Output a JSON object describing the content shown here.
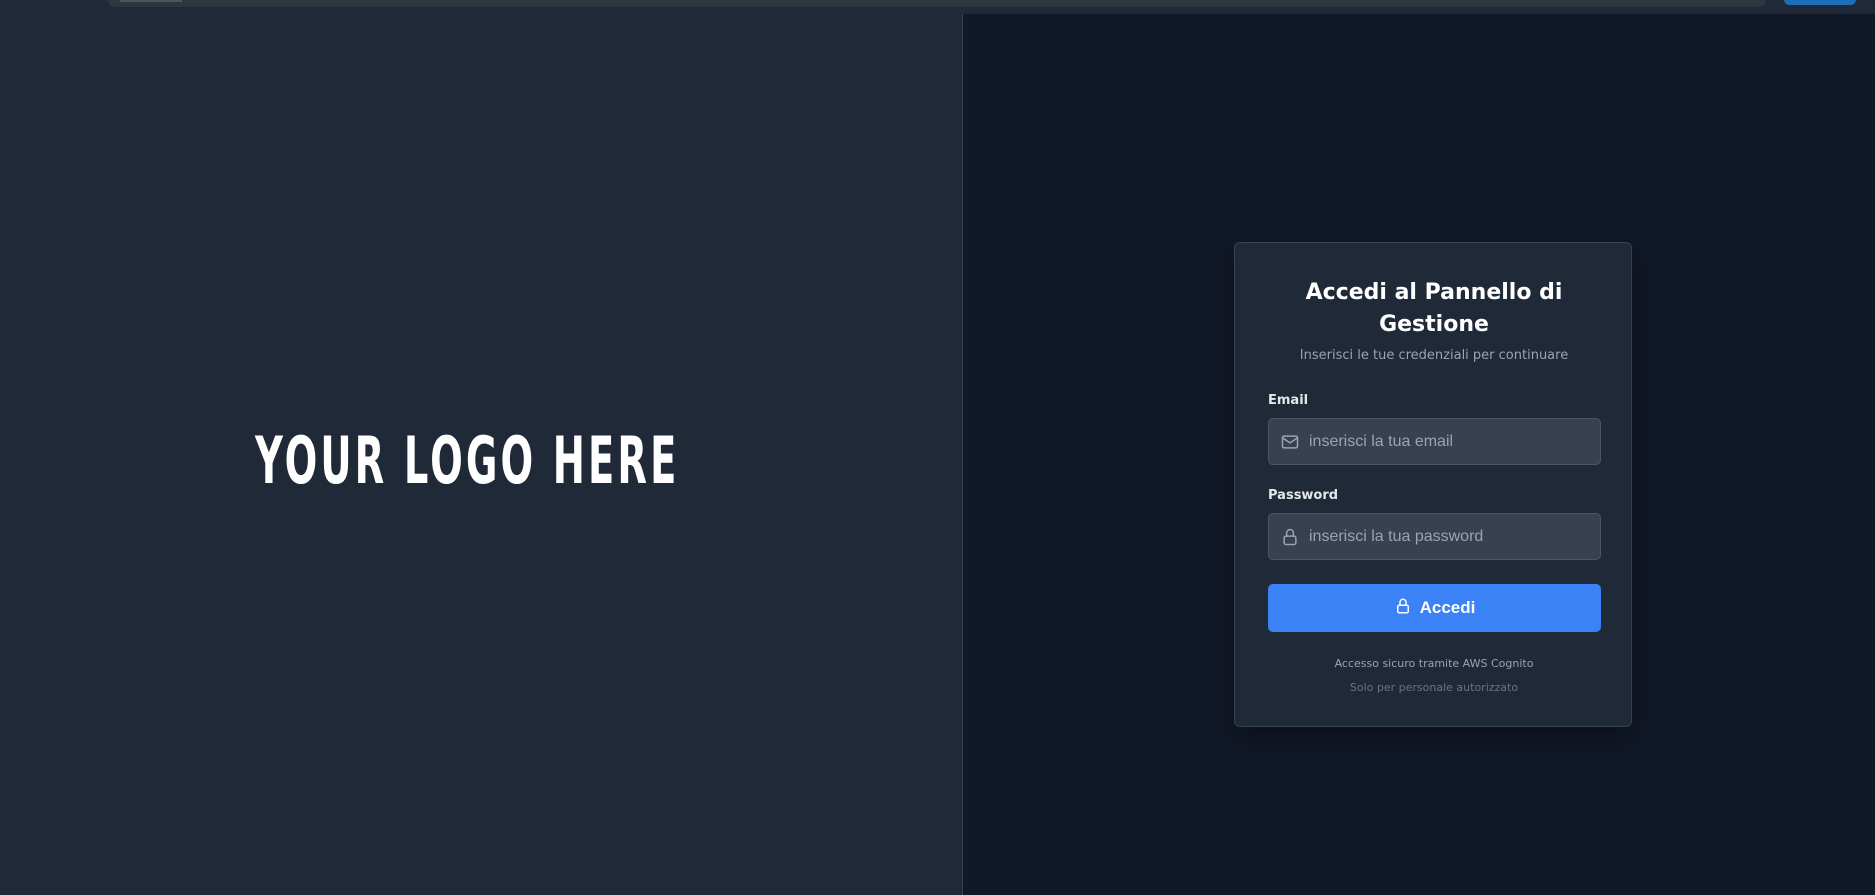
{
  "branding": {
    "logo_text": "YOUR LOGO HERE"
  },
  "login": {
    "title": "Accedi al Pannello di Gestione",
    "subtitle": "Inserisci le tue credenziali per continuare",
    "email": {
      "label": "Email",
      "placeholder": "inserisci la tua email",
      "value": "",
      "icon": "mail-icon"
    },
    "password": {
      "label": "Password",
      "placeholder": "inserisci la tua password",
      "value": "",
      "icon": "lock-icon"
    },
    "submit": {
      "label": "Accedi",
      "icon": "lock-icon"
    },
    "footer_secure": "Accesso sicuro tramite AWS Cognito",
    "footer_authorized": "Solo per personale autorizzato"
  },
  "colors": {
    "left_bg": "#1f2937",
    "right_bg": "#111827",
    "card_bg": "#1f2937",
    "input_bg": "#374151",
    "accent": "#3b82f6",
    "text_primary": "#ffffff",
    "text_muted": "#9ca3af"
  }
}
